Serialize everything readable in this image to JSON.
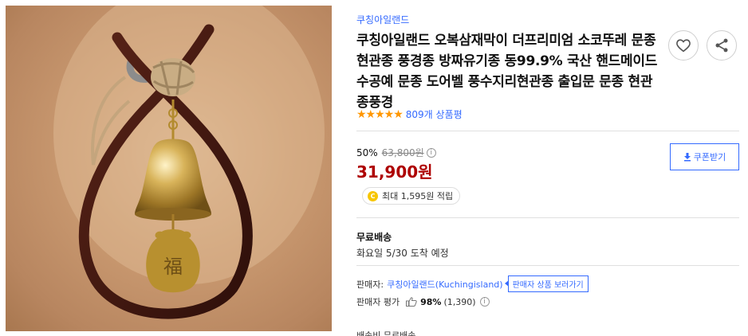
{
  "product": {
    "brand": "쿠칭아일랜드",
    "title": "쿠칭아일랜드 오복삼재막이 더프리미엄 소코뚜레 문종 현관종 풍경종 방짜유기종 동99.9% 국산 핸드메이드 수공예 문종 도어벨 풍수지리현관종 출입문 문종 현관종풍경",
    "stars": "★★★★★",
    "review_count": "809개 상품평",
    "image_icon": "brass-bell-image"
  },
  "pricing": {
    "discount_rate": "50%",
    "original_price": "63,800원",
    "sale_price": "31,900원",
    "coupon_label": "쿠폰받기",
    "cash_text": "최대 1,595원 적립",
    "cash_coin": "C"
  },
  "shipping": {
    "type": "무료배송",
    "arrival": "화요일 5/30 도착 예정"
  },
  "seller": {
    "label": "판매자:",
    "name": "쿠칭아일랜드(Kuchingisland)",
    "tooltip": "판매자 상품 보러가기",
    "rating_label": "판매자 평가",
    "rating_value": "98%",
    "rating_count": "(1,390)"
  },
  "cut_text": "배송비 무료배송",
  "icons": {
    "like": "heart-icon",
    "share": "share-icon",
    "info": "info-icon",
    "coupon": "download-icon",
    "thumb": "thumbs-up-icon"
  },
  "colors": {
    "accent_blue": "#346aff",
    "price_red": "#ae0000",
    "star_orange": "#ff9600"
  }
}
